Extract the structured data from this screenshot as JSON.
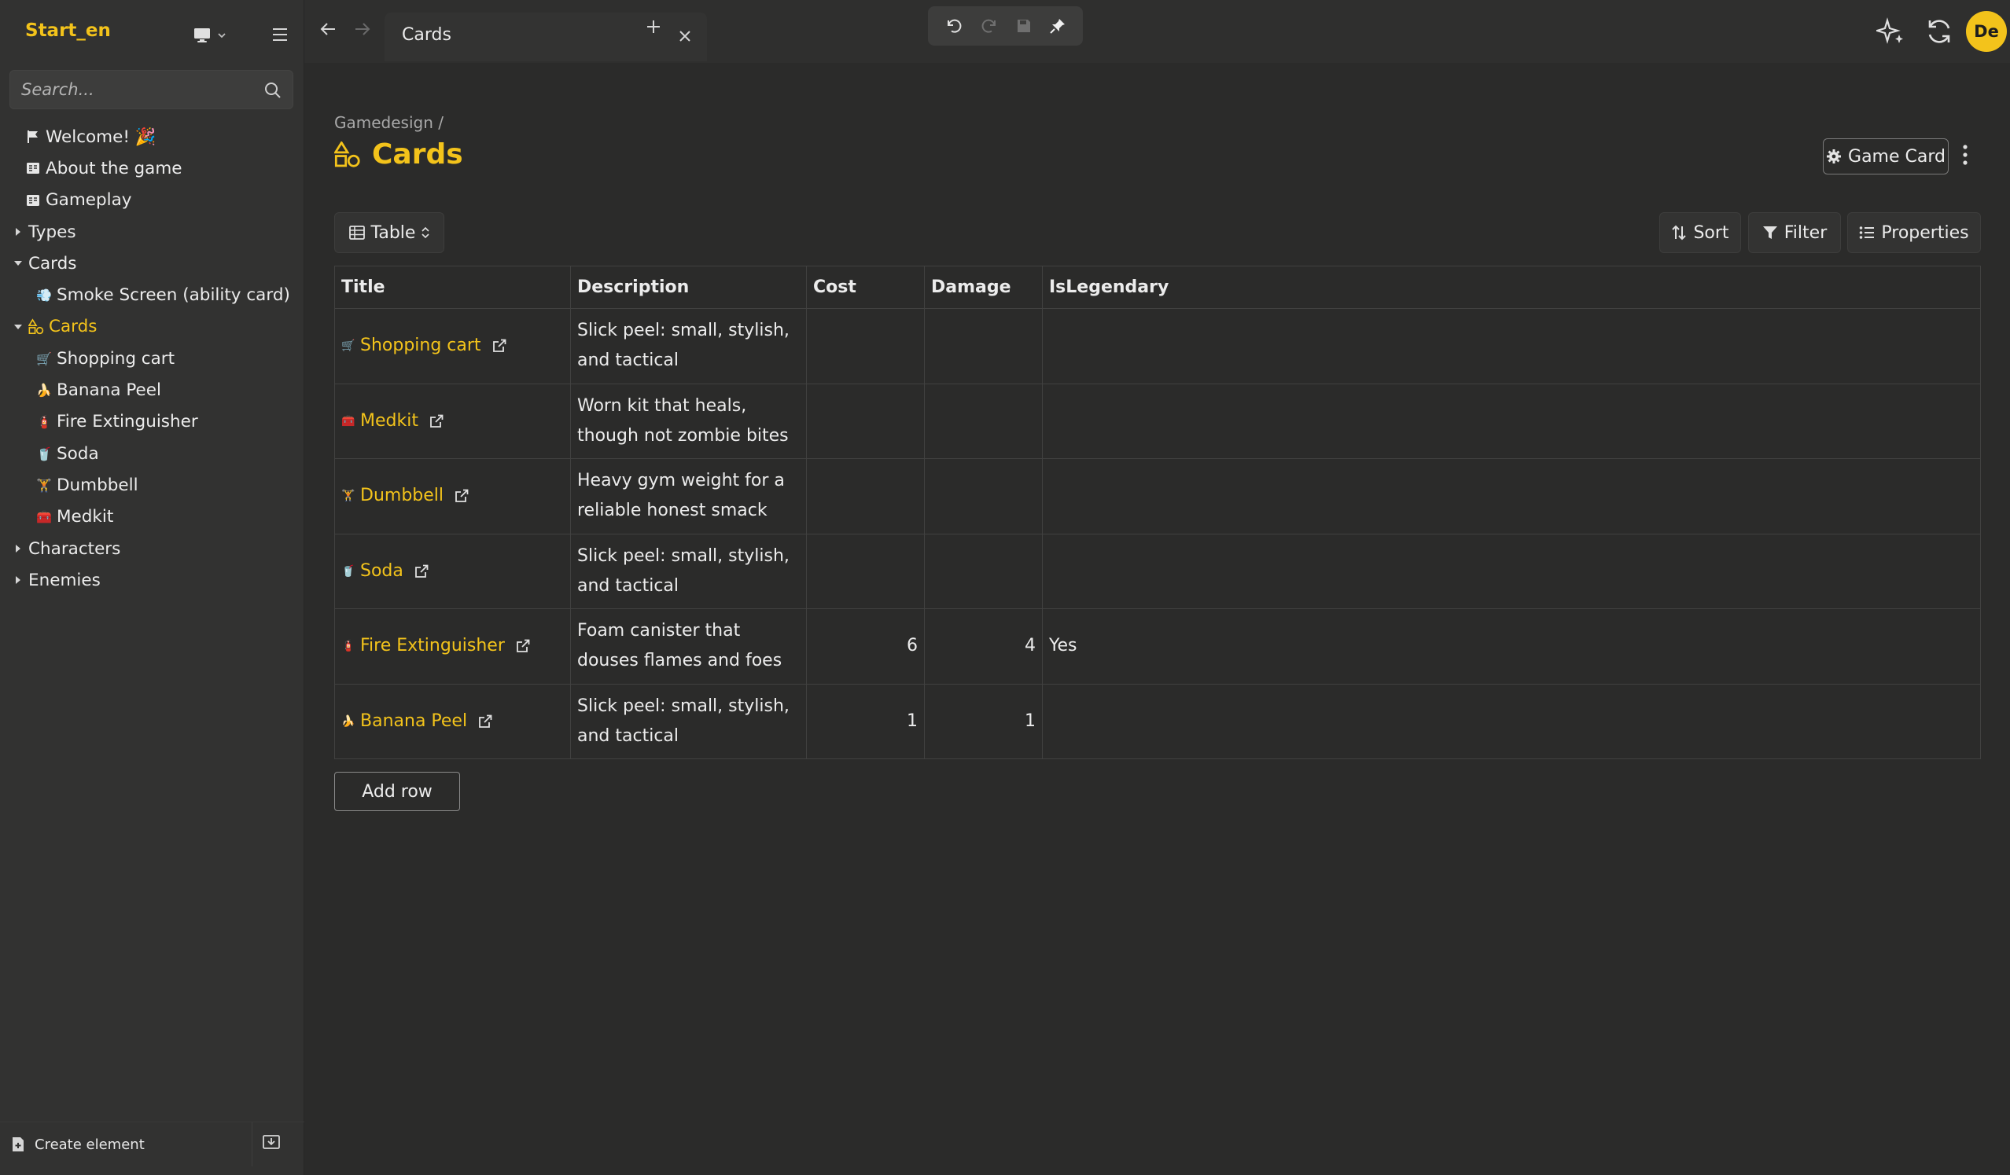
{
  "app": {
    "title": "Start_en"
  },
  "search": {
    "placeholder": "Search..."
  },
  "sidebar": {
    "items": [
      {
        "label": "Welcome! 🎉",
        "icon": "flag-icon"
      },
      {
        "label": "About the game",
        "icon": "document-icon"
      },
      {
        "label": "Gameplay",
        "icon": "document-icon"
      },
      {
        "label": "Types",
        "icon": "chevron-right-icon"
      },
      {
        "label": "Cards",
        "icon": "chevron-down-icon"
      },
      {
        "label": "Smoke Screen (ability card)",
        "icon": "smoke-emoji"
      },
      {
        "label": "Cards",
        "icon": "shapes-icon"
      },
      {
        "label": "Shopping cart",
        "icon": "cart-emoji"
      },
      {
        "label": "Banana Peel",
        "icon": "banana-emoji"
      },
      {
        "label": "Fire Extinguisher",
        "icon": "extinguisher-emoji"
      },
      {
        "label": "Soda",
        "icon": "soda-emoji"
      },
      {
        "label": "Dumbbell",
        "icon": "dumbbell-emoji"
      },
      {
        "label": "Medkit",
        "icon": "medkit-emoji"
      },
      {
        "label": "Characters",
        "icon": "chevron-right-icon"
      },
      {
        "label": "Enemies",
        "icon": "chevron-right-icon"
      }
    ],
    "create_label": "Create element"
  },
  "tabs": [
    {
      "label": "Cards"
    }
  ],
  "page": {
    "breadcrumb": "Gamedesign /",
    "title": "Cards",
    "template_button": "Game Card",
    "view_label": "Table",
    "sort_label": "Sort",
    "filter_label": "Filter",
    "properties_label": "Properties",
    "add_row_label": "Add row"
  },
  "table": {
    "columns": [
      "Title",
      "Description",
      "Cost",
      "Damage",
      "IsLegendary"
    ],
    "rows": [
      {
        "emoji": "🛒",
        "title": "Shopping cart",
        "description": "Slick peel: small, stylish, and tactical",
        "cost": "",
        "damage": "",
        "legendary": ""
      },
      {
        "emoji": "🧰",
        "title": "Medkit",
        "description": "Worn kit that heals, though not zombie bites",
        "cost": "",
        "damage": "",
        "legendary": ""
      },
      {
        "emoji": "🏋",
        "title": "Dumbbell",
        "description": "Heavy gym weight for a reliable honest smack",
        "cost": "",
        "damage": "",
        "legendary": ""
      },
      {
        "emoji": "🥤",
        "title": "Soda",
        "description": "Slick peel: small, stylish, and tactical",
        "cost": "",
        "damage": "",
        "legendary": ""
      },
      {
        "emoji": "🧯",
        "title": "Fire Extinguisher",
        "description": "Foam canister that douses flames and foes",
        "cost": "6",
        "damage": "4",
        "legendary": "Yes"
      },
      {
        "emoji": "🍌",
        "title": "Banana Peel",
        "description": "Slick peel: small, stylish, and tactical",
        "cost": "1",
        "damage": "1",
        "legendary": ""
      }
    ]
  },
  "user": {
    "initials": "De"
  },
  "colors": {
    "accent": "#f3c31b",
    "background": "#2b2b2a",
    "sidebar": "#323231"
  }
}
